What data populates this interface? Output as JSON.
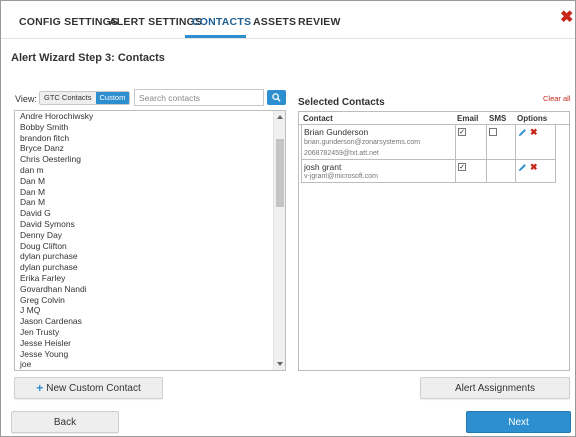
{
  "tabs": [
    {
      "label": "CONFIG SETTINGS"
    },
    {
      "label": "ALERT SETTINGS"
    },
    {
      "label": "CONTACTS"
    },
    {
      "label": "ASSETS"
    },
    {
      "label": "REVIEW"
    }
  ],
  "active_tab": "CONTACTS",
  "close_glyph": "✖",
  "step_title": "Alert Wizard Step 3: Contacts",
  "view": {
    "label": "View:",
    "options": [
      "GTC Contacts",
      "Custom"
    ],
    "selected": "Custom"
  },
  "search": {
    "placeholder": "Search contacts",
    "value": "",
    "icon": "search-icon"
  },
  "contacts": [
    "Andre Horochiwsky",
    "Bobby Smith",
    "brandon fitch",
    "Bryce Danz",
    "Chris Oesterling",
    "dan m",
    "Dan M",
    "Dan M",
    "Dan M",
    "David G",
    "David Symons",
    "Denny Day",
    "Doug Clifton",
    "dylan purchase",
    "dylan purchase",
    "Erika Farley",
    "Govardhan Nandi",
    "Greg Colvin",
    "J MQ",
    "Jason Cardenas",
    "Jen Trusty",
    "Jesse Heisler",
    "Jesse Young",
    "joe"
  ],
  "selected_contacts": {
    "title": "Selected Contacts",
    "clear_all": "Clear all",
    "columns": [
      "Contact",
      "Email",
      "SMS",
      "Options"
    ],
    "rows": [
      {
        "name": "Brian Gunderson",
        "email": "brian.gunderson@zonarsystems.com",
        "sms": "2068782459@txt.att.net",
        "email_checked": true,
        "sms_checked": false
      },
      {
        "name": "josh grant",
        "email": "v-jgrant@microsoft.com",
        "sms": "",
        "email_checked": true,
        "sms_checked": null
      }
    ]
  },
  "buttons": {
    "new_custom_contact": "New Custom Contact",
    "alert_assignments": "Alert Assignments",
    "back": "Back",
    "next": "Next"
  },
  "colors": {
    "accent": "#2d8fcf",
    "danger": "#c7261c",
    "active_tab": "#1f5f93"
  }
}
